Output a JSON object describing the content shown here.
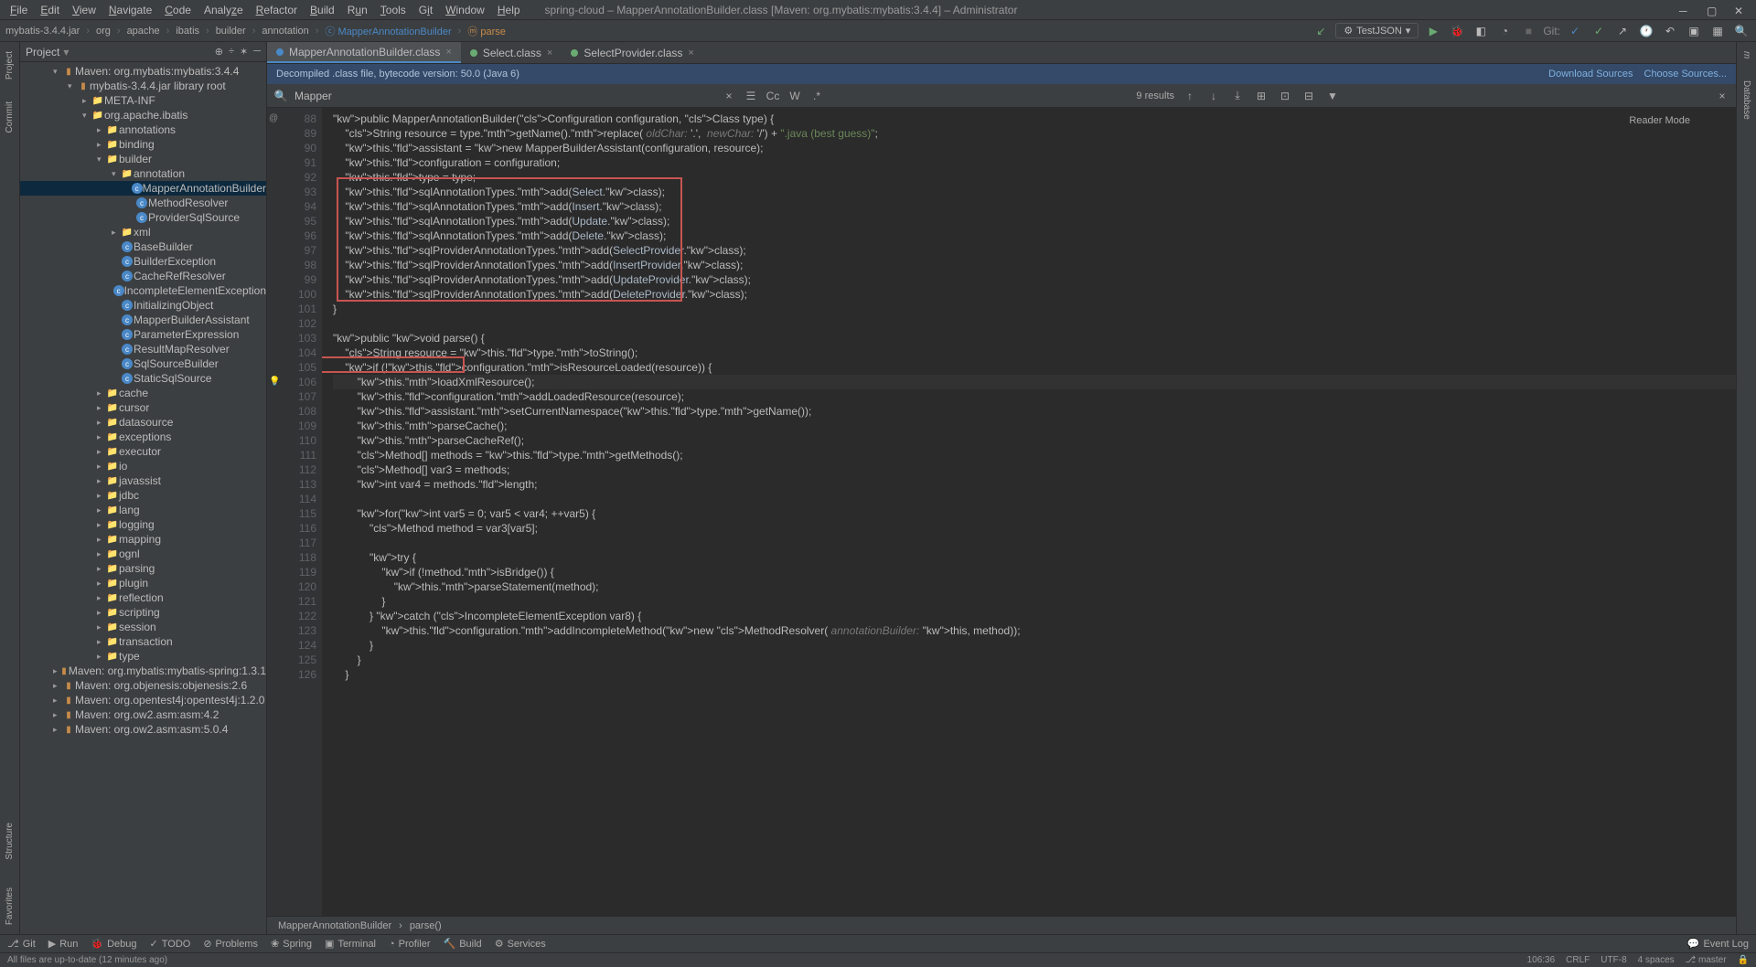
{
  "menu": [
    "File",
    "Edit",
    "View",
    "Navigate",
    "Code",
    "Analyze",
    "Refactor",
    "Build",
    "Run",
    "Tools",
    "Git",
    "Window",
    "Help"
  ],
  "window_title": "spring-cloud – MapperAnnotationBuilder.class [Maven: org.mybatis:mybatis:3.4.4] – Administrator",
  "breadcrumbs": [
    "mybatis-3.4.4.jar",
    "org",
    "apache",
    "ibatis",
    "builder",
    "annotation",
    "MapperAnnotationBuilder",
    "parse"
  ],
  "run_config": "TestJSON",
  "project_panel_title": "Project",
  "tree": {
    "root": "Maven: org.mybatis:mybatis:3.4.4",
    "jar": "mybatis-3.4.4.jar",
    "jar_suffix": "library root",
    "meta": "META-INF",
    "pkg": "org.apache.ibatis",
    "annotations": "annotations",
    "binding": "binding",
    "builder": "builder",
    "annotation": "annotation",
    "classes": [
      "MapperAnnotationBuilder",
      "MethodResolver",
      "ProviderSqlSource"
    ],
    "xml": "xml",
    "builder_classes": [
      "BaseBuilder",
      "BuilderException",
      "CacheRefResolver",
      "IncompleteElementException",
      "InitializingObject",
      "MapperBuilderAssistant",
      "ParameterExpression",
      "ResultMapResolver",
      "SqlSourceBuilder",
      "StaticSqlSource"
    ],
    "pkgs": [
      "cache",
      "cursor",
      "datasource",
      "exceptions",
      "executor",
      "io",
      "javassist",
      "jdbc",
      "lang",
      "logging",
      "mapping",
      "ognl",
      "parsing",
      "plugin",
      "reflection",
      "scripting",
      "session",
      "transaction",
      "type"
    ],
    "mavens": [
      "Maven: org.mybatis:mybatis-spring:1.3.1",
      "Maven: org.objenesis:objenesis:2.6",
      "Maven: org.opentest4j:opentest4j:1.2.0",
      "Maven: org.ow2.asm:asm:4.2",
      "Maven: org.ow2.asm:asm:5.0.4"
    ]
  },
  "tabs": [
    "MapperAnnotationBuilder.class",
    "Select.class",
    "SelectProvider.class"
  ],
  "decompile_msg": "Decompiled .class file, bytecode version: 50.0 (Java 6)",
  "download_sources": "Download Sources",
  "choose_sources": "Choose Sources...",
  "search_value": "Mapper",
  "search_results": "9 results",
  "reader_mode": "Reader Mode",
  "line_start": 88,
  "code_lines": [
    "public MapperAnnotationBuilder(Configuration configuration, Class<?> type) {",
    "    String resource = type.getName().replace( oldChar: '.',  newChar: '/') + \".java (best guess)\";",
    "    this.assistant = new MapperBuilderAssistant(configuration, resource);",
    "    this.configuration = configuration;",
    "    this.type = type;",
    "    this.sqlAnnotationTypes.add(Select.class);",
    "    this.sqlAnnotationTypes.add(Insert.class);",
    "    this.sqlAnnotationTypes.add(Update.class);",
    "    this.sqlAnnotationTypes.add(Delete.class);",
    "    this.sqlProviderAnnotationTypes.add(SelectProvider.class);",
    "    this.sqlProviderAnnotationTypes.add(InsertProvider.class);",
    "    this.sqlProviderAnnotationTypes.add(UpdateProvider.class);",
    "    this.sqlProviderAnnotationTypes.add(DeleteProvider.class);",
    "}",
    "",
    "public void parse() {",
    "    String resource = this.type.toString();",
    "    if (!this.configuration.isResourceLoaded(resource)) {",
    "        this.loadXmlResource();",
    "        this.configuration.addLoadedResource(resource);",
    "        this.assistant.setCurrentNamespace(this.type.getName());",
    "        this.parseCache();",
    "        this.parseCacheRef();",
    "        Method[] methods = this.type.getMethods();",
    "        Method[] var3 = methods;",
    "        int var4 = methods.length;",
    "",
    "        for(int var5 = 0; var5 < var4; ++var5) {",
    "            Method method = var3[var5];",
    "",
    "            try {",
    "                if (!method.isBridge()) {",
    "                    this.parseStatement(method);",
    "                }",
    "            } catch (IncompleteElementException var8) {",
    "                this.configuration.addIncompleteMethod(new MethodResolver( annotationBuilder: this, method));",
    "            }",
    "        }",
    "    }"
  ],
  "editor_crumb": [
    "MapperAnnotationBuilder",
    "parse()"
  ],
  "bottom_tools": [
    "Git",
    "Run",
    "Debug",
    "TODO",
    "Problems",
    "Spring",
    "Terminal",
    "Profiler",
    "Build",
    "Services"
  ],
  "event_log": "Event Log",
  "status_msg": "All files are up-to-date (12 minutes ago)",
  "status_right": {
    "pos": "106:36",
    "eol": "CRLF",
    "enc": "UTF-8",
    "indent": "4 spaces",
    "branch": "master"
  }
}
